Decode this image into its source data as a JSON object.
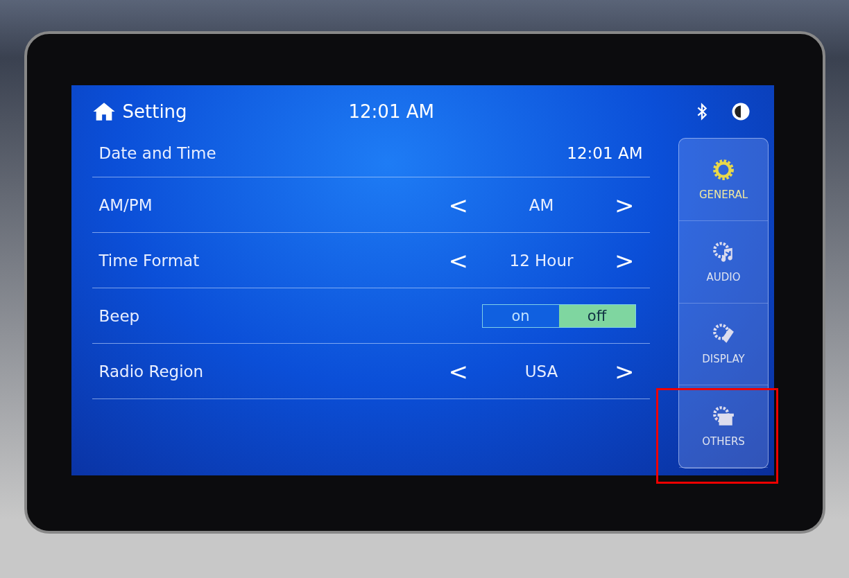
{
  "header": {
    "title": "Setting",
    "clock": "12:01 AM"
  },
  "rows": [
    {
      "kind": "value",
      "label": "Date and Time",
      "value": "12:01 AM"
    },
    {
      "kind": "selector",
      "label": "AM/PM",
      "value": "AM",
      "prev": "<",
      "next": ">"
    },
    {
      "kind": "selector",
      "label": "Time Format",
      "value": "12 Hour",
      "prev": "<",
      "next": ">"
    },
    {
      "kind": "toggle",
      "label": "Beep",
      "options": [
        {
          "label": "on",
          "selected": false
        },
        {
          "label": "off",
          "selected": true
        }
      ]
    },
    {
      "kind": "selector",
      "label": "Radio Region",
      "value": "USA",
      "prev": "<",
      "next": ">"
    }
  ],
  "sidebar": {
    "items": [
      {
        "label": "GENERAL",
        "kind": "gear",
        "selected": true
      },
      {
        "label": "AUDIO",
        "kind": "audio",
        "selected": false
      },
      {
        "label": "DISPLAY",
        "kind": "display",
        "selected": false
      },
      {
        "label": "OTHERS",
        "kind": "others",
        "selected": false
      }
    ]
  }
}
